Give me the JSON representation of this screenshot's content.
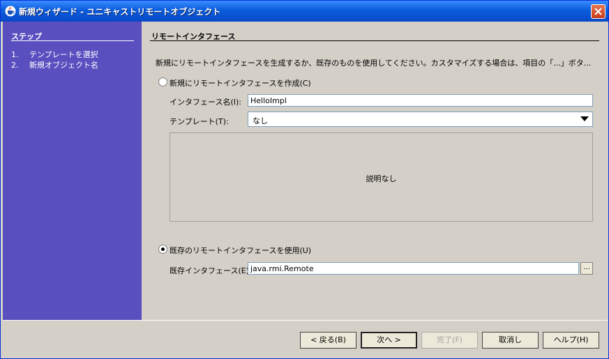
{
  "window": {
    "title": "新規ウィザード - ユニキャストリモートオブジェクト"
  },
  "steps": {
    "title": "ステップ",
    "items": [
      {
        "num": "1.",
        "label": "テンプレートを選択"
      },
      {
        "num": "2.",
        "label": "新規オブジェクト名"
      }
    ]
  },
  "panel": {
    "title": "リモートインタフェース",
    "description": "新規にリモートインタフェースを生成するか、既存のものを使用してください。カスタマイズする場合は、項目の「...」ボタ...",
    "new_radio_label": "新規にリモートインタフェースを作成(C)",
    "interface_name_label": "インタフェース名(I):",
    "interface_name_value": "HelloImpl",
    "template_label": "テンプレート(T):",
    "template_value": "なし",
    "template_description": "説明なし",
    "existing_radio_label": "既存のリモートインタフェースを使用(U)",
    "existing_interface_label": "既存インタフェース(E):",
    "existing_interface_value": "java.rmi.Remote",
    "browse_label": "...",
    "selected_option": "existing"
  },
  "buttons": {
    "back": "< 戻る(B)",
    "next": "次へ >",
    "finish": "完了(F)",
    "cancel": "取消し",
    "help": "ヘルプ(H)"
  }
}
